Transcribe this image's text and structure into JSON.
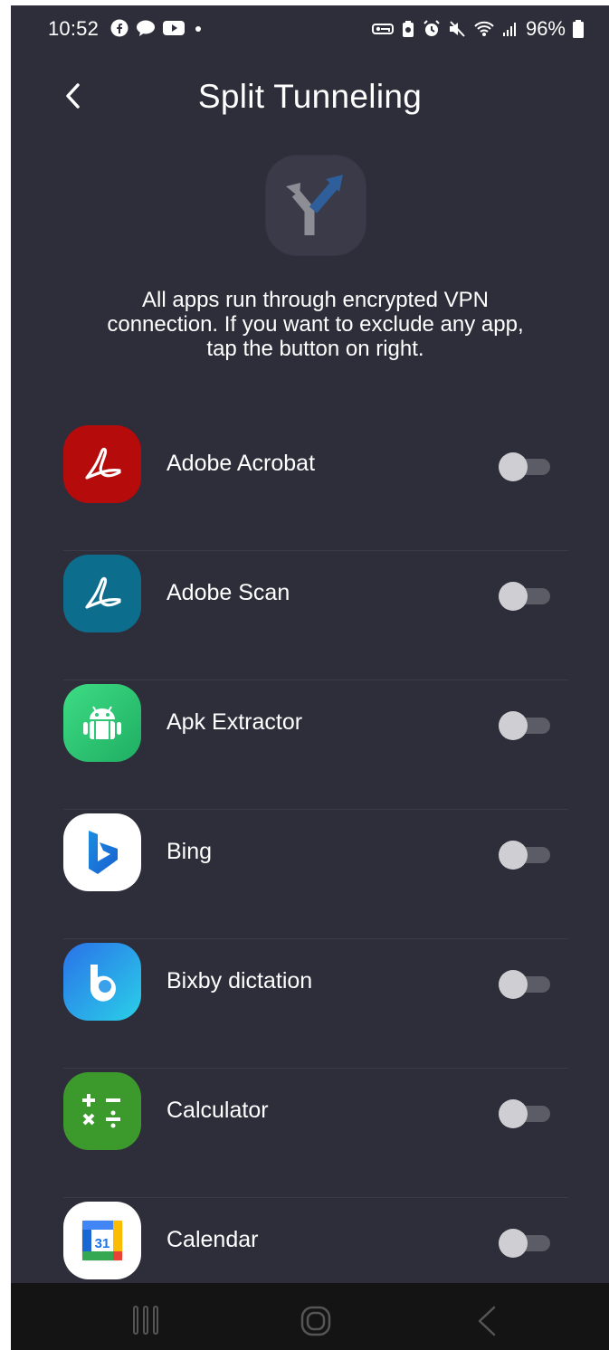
{
  "status_bar": {
    "time": "10:52",
    "battery": "96%",
    "left_icons": [
      "facebook-icon",
      "chat-icon",
      "youtube-icon",
      "dot-icon"
    ],
    "right_icons": [
      "vpn-key-icon",
      "battery-saver-icon",
      "alarm-icon",
      "mute-icon",
      "wifi-icon",
      "signal-icon",
      "battery-icon"
    ]
  },
  "header": {
    "title": "Split Tunneling",
    "back_icon": "chevron-left-icon"
  },
  "hero_icon": "split-arrow-icon",
  "description": "All apps run through encrypted VPN connection. If you want to exclude any app, tap the button on right.",
  "apps": [
    {
      "name": "Adobe Acrobat",
      "icon": "adobe-acrobat-icon",
      "enabled": false
    },
    {
      "name": "Adobe Scan",
      "icon": "adobe-scan-icon",
      "enabled": false
    },
    {
      "name": "Apk Extractor",
      "icon": "apk-extractor-icon",
      "enabled": false
    },
    {
      "name": "Bing",
      "icon": "bing-icon",
      "enabled": false
    },
    {
      "name": "Bixby dictation",
      "icon": "bixby-dictation-icon",
      "enabled": false
    },
    {
      "name": "Calculator",
      "icon": "calculator-icon",
      "enabled": false
    },
    {
      "name": "Calendar",
      "icon": "calendar-icon",
      "enabled": false,
      "calendar_day": "31"
    }
  ],
  "nav_bar": {
    "icons": [
      "recent-apps-icon",
      "home-icon",
      "back-nav-icon"
    ]
  },
  "colors": {
    "background": "#2e2d3a",
    "hero_tile": "#3a3a49",
    "text": "#ffffff",
    "toggle_knob": "#cfcfd3",
    "toggle_track": "#5c5c66",
    "nav_bar": "#141414"
  }
}
